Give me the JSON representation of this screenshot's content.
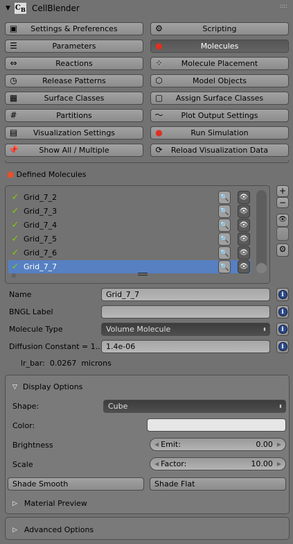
{
  "panel": {
    "title": "CellBlender",
    "logo": "CB"
  },
  "nav": [
    {
      "label": "Settings & Preferences",
      "icon": "settings-icon"
    },
    {
      "label": "Scripting",
      "icon": "scripting-icon"
    },
    {
      "label": "Parameters",
      "icon": "parameters-icon"
    },
    {
      "label": "Molecules",
      "icon": "molecule-icon",
      "active": true
    },
    {
      "label": "Reactions",
      "icon": "reactions-arrow-icon"
    },
    {
      "label": "Molecule Placement",
      "icon": "placement-grid-icon"
    },
    {
      "label": "Release Patterns",
      "icon": "clock-icon"
    },
    {
      "label": "Model Objects",
      "icon": "mesh-object-icon"
    },
    {
      "label": "Surface Classes",
      "icon": "checker-cube-icon"
    },
    {
      "label": "Assign Surface Classes",
      "icon": "cube-icon"
    },
    {
      "label": "Partitions",
      "icon": "grid-icon"
    },
    {
      "label": "Plot Output Settings",
      "icon": "plot-icon"
    },
    {
      "label": "Visualization Settings",
      "icon": "visualization-icon"
    },
    {
      "label": "Run Simulation",
      "icon": "record-icon"
    },
    {
      "label": "Show All / Multiple",
      "icon": "pin-icon"
    },
    {
      "label": "Reload Visualization Data",
      "icon": "reload-icon"
    }
  ],
  "molecules": {
    "header": "Defined Molecules",
    "items": [
      "Grid_7_2",
      "Grid_7_3",
      "Grid_7_4",
      "Grid_7_5",
      "Grid_7_6",
      "Grid_7_7"
    ],
    "selected": "Grid_7_7"
  },
  "props": {
    "name_label": "Name",
    "name_value": "Grid_7_7",
    "bngl_label": "BNGL Label",
    "bngl_value": "",
    "type_label": "Molecule Type",
    "type_value": "Volume Molecule",
    "diff_label": "Diffusion Constant = 1....",
    "diff_value": "1.4e-06",
    "lr_bar": "lr_bar:  0.0267  microns"
  },
  "display": {
    "header": "Display Options",
    "shape_label": "Shape:",
    "shape_value": "Cube",
    "color_label": "Color:",
    "color_value": "#e6e6e6",
    "brightness_label": "Brightness",
    "emit_label": "Emit:",
    "emit_value": "0.00",
    "scale_label": "Scale",
    "factor_label": "Factor:",
    "factor_value": "10.00",
    "smooth": "Shade Smooth",
    "flat": "Shade Flat",
    "material": "Material Preview"
  },
  "advanced": "Advanced Options"
}
